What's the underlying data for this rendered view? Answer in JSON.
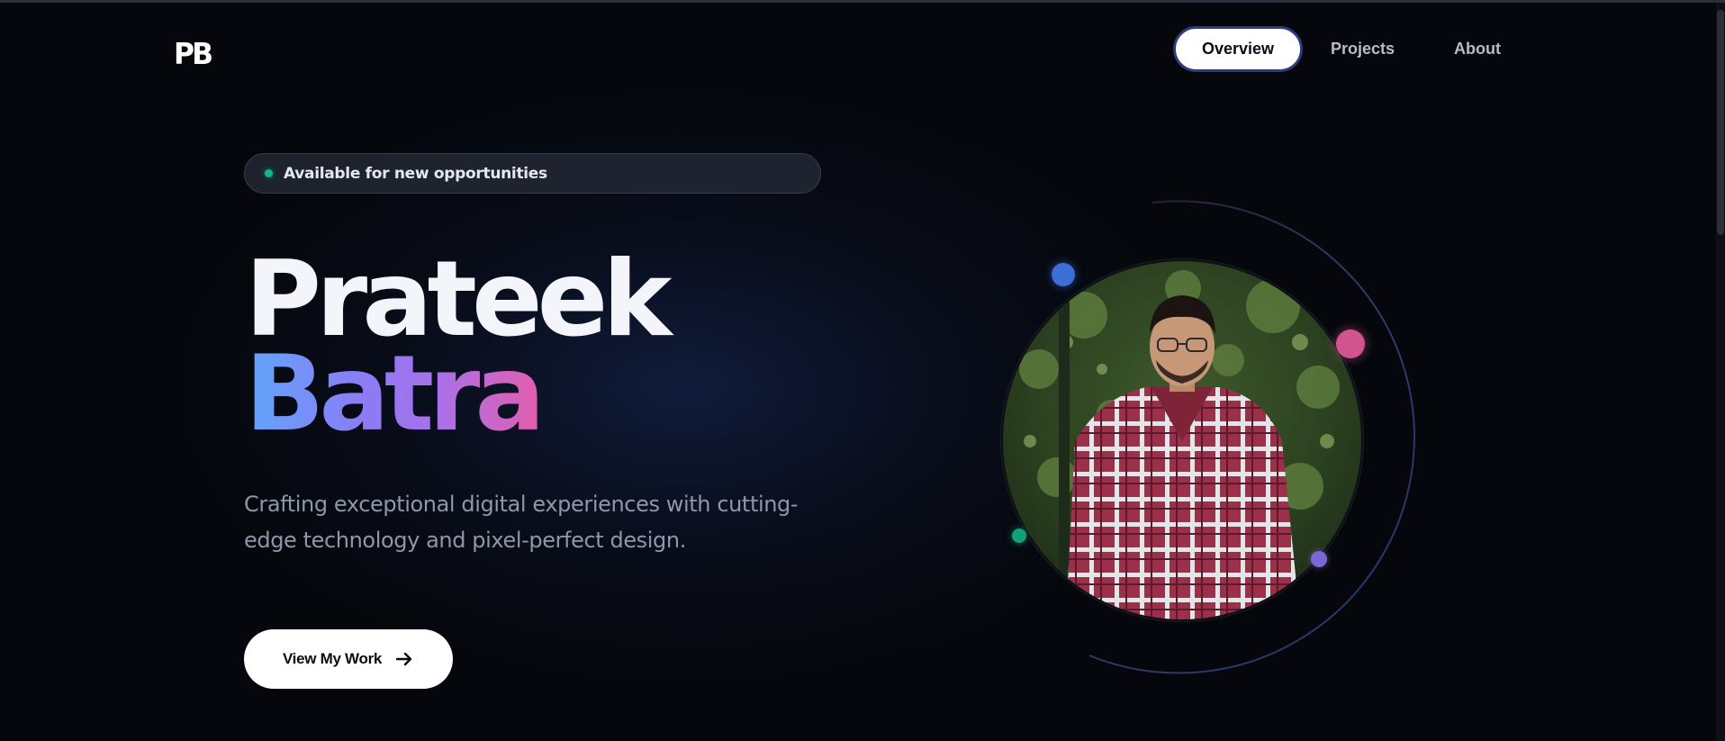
{
  "logo": {
    "text": "PB"
  },
  "nav": {
    "items": [
      {
        "label": "Overview",
        "active": true
      },
      {
        "label": "Projects",
        "active": false
      },
      {
        "label": "About",
        "active": false
      }
    ]
  },
  "hero": {
    "badge": {
      "text": "Available for new opportunities",
      "status_color": "#10b981"
    },
    "first_name": "Prateek",
    "last_name": "Batra",
    "tagline": "Crafting exceptional digital experiences with cutting-edge technology and pixel-perfect design.",
    "cta": {
      "label": "View My Work",
      "icon": "arrow-right-icon"
    }
  },
  "portrait": {
    "description_icon": "profile-photo",
    "accent_dots": [
      {
        "name": "blue-dot",
        "color": "#3b6fd6"
      },
      {
        "name": "pink-dot",
        "color": "#d0558f"
      },
      {
        "name": "green-dot",
        "color": "#10a37a"
      },
      {
        "name": "purple-dot",
        "color": "#7b68d8"
      }
    ]
  },
  "colors": {
    "background": "#05070c",
    "accent_gradient": [
      "#60a5fa",
      "#8b7cf6",
      "#a970e8",
      "#e45eae"
    ],
    "nav_active_border": "#2b3c7c"
  }
}
